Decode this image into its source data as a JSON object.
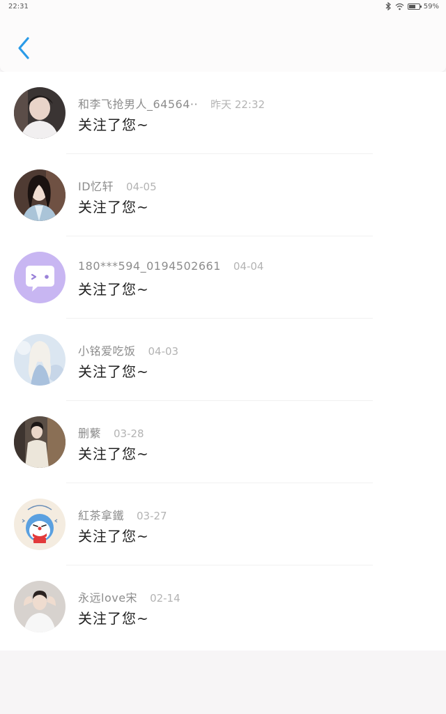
{
  "status_bar": {
    "time": "22:31",
    "battery": "59%",
    "battery_level": 0.59
  },
  "header": {
    "back_icon": "chevron-left-icon",
    "accent_color": "#2a9be8"
  },
  "followers": [
    {
      "name": "和李飞抢男人_64564··",
      "date": "昨天 22:32",
      "message": "关注了您~",
      "avatar": "photo-young-man-white-hoodie"
    },
    {
      "name": "ID忆轩",
      "date": "04-05",
      "message": "关注了您~",
      "avatar": "photo-costume-drama-character"
    },
    {
      "name": "180***594_0194502661",
      "date": "04-04",
      "message": "关注了您~",
      "avatar": "default-chat-bubble-avatar"
    },
    {
      "name": "小铭爱吃饭",
      "date": "04-03",
      "message": "关注了您~",
      "avatar": "photo-anime-angel"
    },
    {
      "name": "删蘩",
      "date": "03-28",
      "message": "关注了您~",
      "avatar": "photo-man-white-coat"
    },
    {
      "name": "紅茶拿鐵",
      "date": "03-27",
      "message": "关注了您~",
      "avatar": "doraemon-lucky-avatar"
    },
    {
      "name": "永远love宋",
      "date": "02-14",
      "message": "关注了您~",
      "avatar": "photo-boy-heart-hands"
    }
  ]
}
